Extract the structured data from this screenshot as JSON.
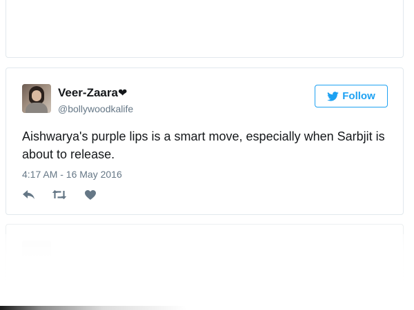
{
  "tweet": {
    "display_name": "Veer-Zaara",
    "name_heart": "❤",
    "handle": "@bollywoodkalife",
    "follow_label": "Follow",
    "text": "Aishwarya's purple lips is a smart move, especially when Sarbjit is about to release.",
    "timestamp": "4:17 AM - 16 May 2016",
    "actions": [
      "reply-icon",
      "retweet-icon",
      "like-icon"
    ]
  },
  "colors": {
    "accent": "#1da1f2",
    "text_primary": "#14171a",
    "text_secondary": "#657786",
    "border": "#e1e8ed",
    "icon": "#657786"
  }
}
